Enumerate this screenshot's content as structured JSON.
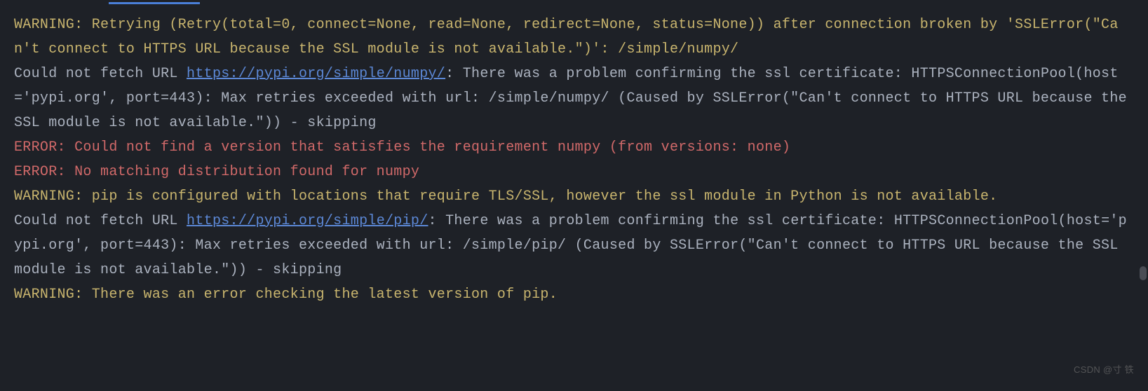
{
  "terminal": {
    "lines": [
      {
        "type": "warning",
        "segments": [
          {
            "class": "warning",
            "text": "WARNING: Retrying (Retry(total=0, connect=None, read=None, redirect=None, status=None)) after connection broken by 'SSLError(\"Can't connect to HTTPS URL because the SSL module is not available.\")': /simple/numpy/"
          }
        ]
      },
      {
        "type": "plain",
        "segments": [
          {
            "class": "plain",
            "text": "Could not fetch URL "
          },
          {
            "class": "link",
            "text": "https://pypi.org/simple/numpy/"
          },
          {
            "class": "plain",
            "text": ": There was a problem confirming the ssl certificate: HTTPSConnectionPool(host='pypi.org', port=443): Max retries exceeded with url: /simple/numpy/ (Caused by SSLError(\"Can't connect to HTTPS URL because the SSL module is not available.\")) - skipping"
          }
        ]
      },
      {
        "type": "error",
        "segments": [
          {
            "class": "error",
            "text": "ERROR: Could not find a version that satisfies the requirement numpy (from versions: none)"
          }
        ]
      },
      {
        "type": "error",
        "segments": [
          {
            "class": "error",
            "text": "ERROR: No matching distribution found for numpy"
          }
        ]
      },
      {
        "type": "warning",
        "segments": [
          {
            "class": "warning",
            "text": "WARNING: pip is configured with locations that require TLS/SSL, however the ssl module in Python is not available."
          }
        ]
      },
      {
        "type": "plain",
        "segments": [
          {
            "class": "plain",
            "text": "Could not fetch URL "
          },
          {
            "class": "link",
            "text": "https://pypi.org/simple/pip/"
          },
          {
            "class": "plain",
            "text": ": There was a problem confirming the ssl certificate: HTTPSConnectionPool(host='pypi.org', port=443): Max retries exceeded with url: /simple/pip/ (Caused by SSLError(\"Can't connect to HTTPS URL because the SSL module is not available.\")) - skipping"
          }
        ]
      },
      {
        "type": "warning",
        "segments": [
          {
            "class": "warning",
            "text": "WARNING: There was an error checking the latest version of pip."
          }
        ]
      }
    ]
  },
  "watermark": "CSDN @寸 铁"
}
